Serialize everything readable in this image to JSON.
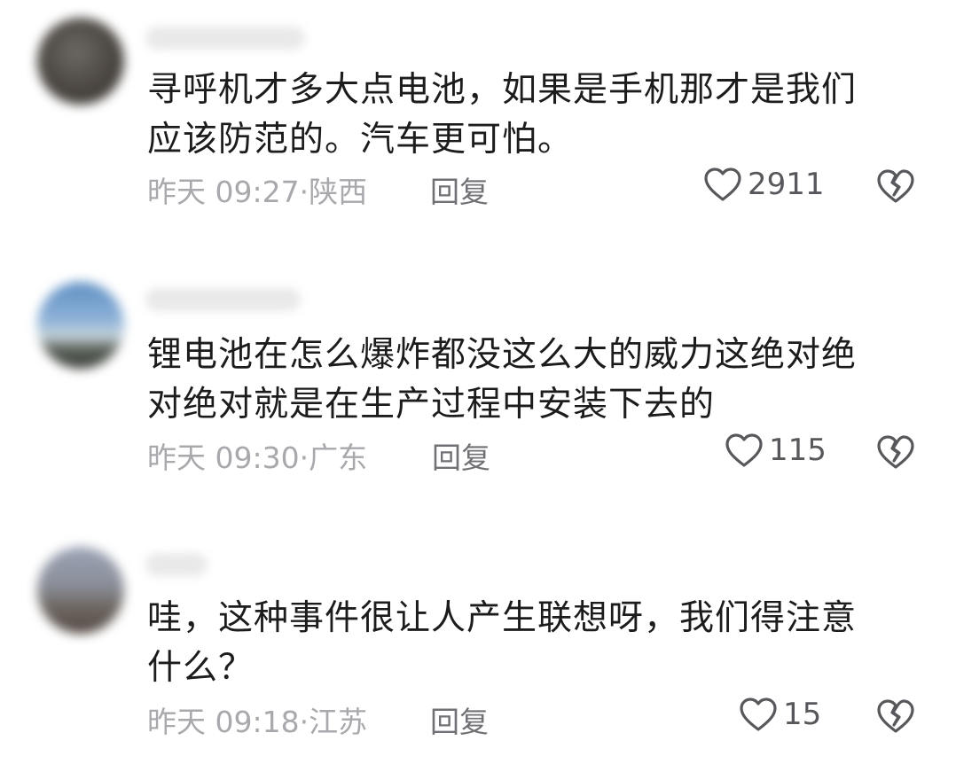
{
  "comments": [
    {
      "text_line1": "寻呼机才多大点电池，如果是手机那才是我们",
      "text_line2": "应该防范的。汽车更可怕。",
      "time": "昨天 09:27",
      "location": "陕西",
      "reply_label": "回复",
      "likes": "2911"
    },
    {
      "text_line1": "锂电池在怎么爆炸都没这么大的威力这绝对绝",
      "text_line2": "对绝对就是在生产过程中安装下去的",
      "time": "昨天 09:30",
      "location": "广东",
      "reply_label": "回复",
      "likes": "115"
    },
    {
      "text_line1": "哇，这种事件很让人产生联想呀，我们得注意",
      "text_line2": "什么？",
      "time": "昨天 09:18",
      "location": "江苏",
      "reply_label": "回复",
      "likes": "15"
    }
  ],
  "colors": {
    "text": "#1c1c1c",
    "meta": "#a9a9ad",
    "icon": "#58585c"
  },
  "icons": [
    "heart-outline-icon",
    "broken-heart-icon"
  ]
}
